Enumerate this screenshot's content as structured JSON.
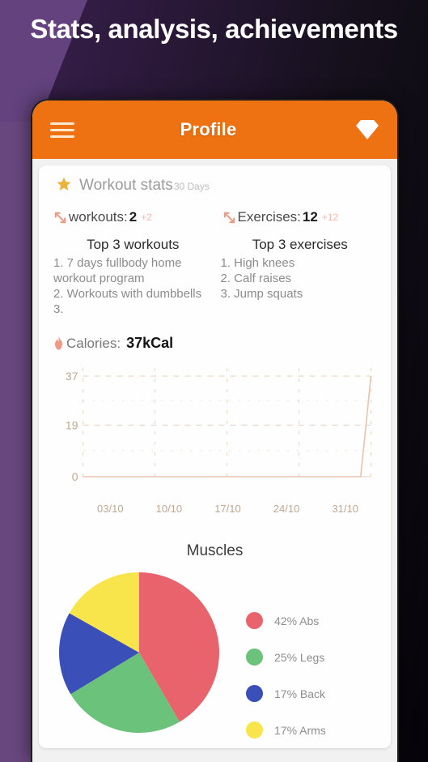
{
  "headline": "Stats, analysis, achievements",
  "appbar": {
    "title": "Profile",
    "menu_icon": "hamburger-menu-icon",
    "premium_icon": "diamond-gem-icon"
  },
  "stats_card": {
    "star_icon": "star-icon",
    "title": "Workout stats",
    "period": "30 Days",
    "metrics": [
      {
        "icon": "trend-arrow-icon",
        "label": "workouts:",
        "value": "2",
        "delta": "+2"
      },
      {
        "icon": "trend-arrow-icon",
        "label": "Exercises:",
        "value": "12",
        "delta": "+12"
      }
    ],
    "top_workouts": {
      "heading": "Top 3 workouts",
      "items": [
        "1. 7 days fullbody home workout program",
        "2. Workouts with dumbbells",
        "3."
      ]
    },
    "top_exercises": {
      "heading": "Top 3 exercises",
      "items": [
        "1. High knees",
        "2. Calf raises",
        "3. Jump squats"
      ]
    },
    "calories": {
      "icon": "flame-icon",
      "label": "Calories:",
      "value": "37kCal"
    }
  },
  "chart_data": [
    {
      "type": "line",
      "title": "",
      "xlabel": "",
      "ylabel": "",
      "ylim": [
        0,
        37
      ],
      "yticks": [
        "0",
        "19",
        "37"
      ],
      "grid": true,
      "categories": [
        "03/10",
        "10/10",
        "17/10",
        "24/10",
        "31/10"
      ],
      "x": [
        "03/10",
        "04/10",
        "05/10",
        "06/10",
        "07/10",
        "08/10",
        "09/10",
        "10/10",
        "11/10",
        "12/10",
        "13/10",
        "14/10",
        "15/10",
        "16/10",
        "17/10",
        "18/10",
        "19/10",
        "20/10",
        "21/10",
        "22/10",
        "23/10",
        "24/10",
        "25/10",
        "26/10",
        "27/10",
        "28/10",
        "29/10",
        "30/10",
        "31/10"
      ],
      "values": [
        0,
        0,
        0,
        0,
        0,
        0,
        0,
        0,
        0,
        0,
        0,
        0,
        0,
        0,
        0,
        0,
        0,
        0,
        0,
        0,
        0,
        0,
        0,
        0,
        0,
        0,
        0,
        0,
        37
      ],
      "line_color": "#e8c2ad",
      "axis_label_color": "#c0a78f"
    },
    {
      "type": "pie",
      "title": "Muscles",
      "legend_position": "right",
      "categories": [
        "Abs",
        "Legs",
        "Back",
        "Arms"
      ],
      "values": [
        42,
        25,
        17,
        17
      ],
      "labels": [
        "42% Abs",
        "25% Legs",
        "17% Back",
        "17% Arms"
      ],
      "colors": [
        "#e8636b",
        "#6bc27b",
        "#3a4fb8",
        "#f8e54b"
      ]
    }
  ],
  "colors": {
    "accent_orange": "#ef7212",
    "background_purple": "#63427d",
    "star_gold": "#e9b33c",
    "salmon": "#ef9a85"
  }
}
